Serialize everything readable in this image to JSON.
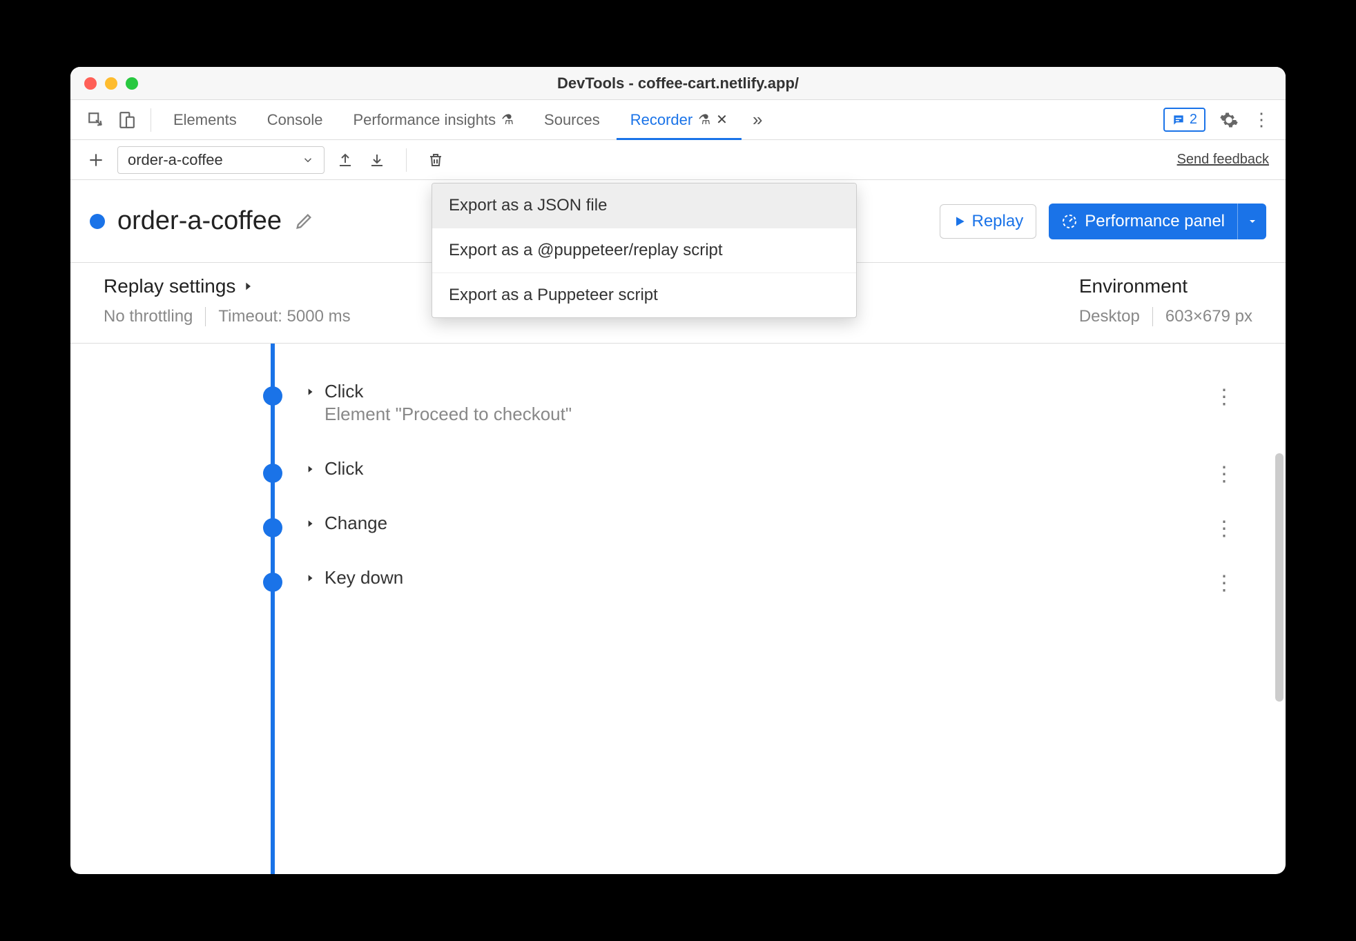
{
  "window": {
    "title": "DevTools - coffee-cart.netlify.app/"
  },
  "tabs": {
    "elements": "Elements",
    "console": "Console",
    "perf_insights": "Performance insights",
    "sources": "Sources",
    "recorder": "Recorder"
  },
  "badge": {
    "count": "2"
  },
  "toolbar": {
    "recording_name": "order-a-coffee",
    "feedback": "Send feedback"
  },
  "header": {
    "recording_title": "order-a-coffee",
    "replay_label": "Replay",
    "perf_label": "Performance panel"
  },
  "settings": {
    "replay_header": "Replay settings",
    "throttling": "No throttling",
    "timeout": "Timeout: 5000 ms",
    "env_header": "Environment",
    "device": "Desktop",
    "viewport": "603×679 px"
  },
  "steps": [
    {
      "label": "Click",
      "detail": "Element \"Proceed to checkout\""
    },
    {
      "label": "Click",
      "detail": ""
    },
    {
      "label": "Change",
      "detail": ""
    },
    {
      "label": "Key down",
      "detail": ""
    }
  ],
  "export_menu": {
    "items": [
      "Export as a JSON file",
      "Export as a @puppeteer/replay script",
      "Export as a Puppeteer script"
    ]
  }
}
